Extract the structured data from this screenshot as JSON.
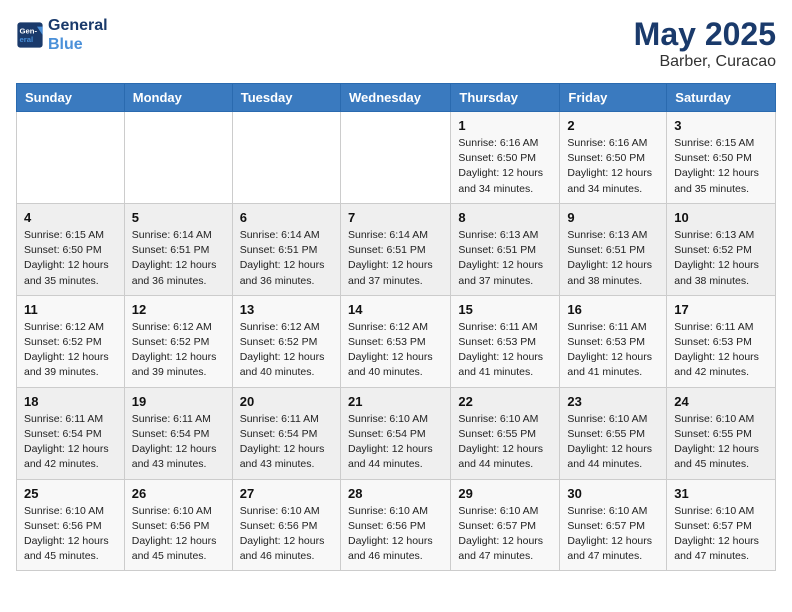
{
  "header": {
    "logo_line1": "General",
    "logo_line2": "Blue",
    "title": "May 2025",
    "subtitle": "Barber, Curacao"
  },
  "days_of_week": [
    "Sunday",
    "Monday",
    "Tuesday",
    "Wednesday",
    "Thursday",
    "Friday",
    "Saturday"
  ],
  "weeks": [
    [
      {
        "day": "",
        "info": ""
      },
      {
        "day": "",
        "info": ""
      },
      {
        "day": "",
        "info": ""
      },
      {
        "day": "",
        "info": ""
      },
      {
        "day": "1",
        "info": "Sunrise: 6:16 AM\nSunset: 6:50 PM\nDaylight: 12 hours and 34 minutes."
      },
      {
        "day": "2",
        "info": "Sunrise: 6:16 AM\nSunset: 6:50 PM\nDaylight: 12 hours and 34 minutes."
      },
      {
        "day": "3",
        "info": "Sunrise: 6:15 AM\nSunset: 6:50 PM\nDaylight: 12 hours and 35 minutes."
      }
    ],
    [
      {
        "day": "4",
        "info": "Sunrise: 6:15 AM\nSunset: 6:50 PM\nDaylight: 12 hours and 35 minutes."
      },
      {
        "day": "5",
        "info": "Sunrise: 6:14 AM\nSunset: 6:51 PM\nDaylight: 12 hours and 36 minutes."
      },
      {
        "day": "6",
        "info": "Sunrise: 6:14 AM\nSunset: 6:51 PM\nDaylight: 12 hours and 36 minutes."
      },
      {
        "day": "7",
        "info": "Sunrise: 6:14 AM\nSunset: 6:51 PM\nDaylight: 12 hours and 37 minutes."
      },
      {
        "day": "8",
        "info": "Sunrise: 6:13 AM\nSunset: 6:51 PM\nDaylight: 12 hours and 37 minutes."
      },
      {
        "day": "9",
        "info": "Sunrise: 6:13 AM\nSunset: 6:51 PM\nDaylight: 12 hours and 38 minutes."
      },
      {
        "day": "10",
        "info": "Sunrise: 6:13 AM\nSunset: 6:52 PM\nDaylight: 12 hours and 38 minutes."
      }
    ],
    [
      {
        "day": "11",
        "info": "Sunrise: 6:12 AM\nSunset: 6:52 PM\nDaylight: 12 hours and 39 minutes."
      },
      {
        "day": "12",
        "info": "Sunrise: 6:12 AM\nSunset: 6:52 PM\nDaylight: 12 hours and 39 minutes."
      },
      {
        "day": "13",
        "info": "Sunrise: 6:12 AM\nSunset: 6:52 PM\nDaylight: 12 hours and 40 minutes."
      },
      {
        "day": "14",
        "info": "Sunrise: 6:12 AM\nSunset: 6:53 PM\nDaylight: 12 hours and 40 minutes."
      },
      {
        "day": "15",
        "info": "Sunrise: 6:11 AM\nSunset: 6:53 PM\nDaylight: 12 hours and 41 minutes."
      },
      {
        "day": "16",
        "info": "Sunrise: 6:11 AM\nSunset: 6:53 PM\nDaylight: 12 hours and 41 minutes."
      },
      {
        "day": "17",
        "info": "Sunrise: 6:11 AM\nSunset: 6:53 PM\nDaylight: 12 hours and 42 minutes."
      }
    ],
    [
      {
        "day": "18",
        "info": "Sunrise: 6:11 AM\nSunset: 6:54 PM\nDaylight: 12 hours and 42 minutes."
      },
      {
        "day": "19",
        "info": "Sunrise: 6:11 AM\nSunset: 6:54 PM\nDaylight: 12 hours and 43 minutes."
      },
      {
        "day": "20",
        "info": "Sunrise: 6:11 AM\nSunset: 6:54 PM\nDaylight: 12 hours and 43 minutes."
      },
      {
        "day": "21",
        "info": "Sunrise: 6:10 AM\nSunset: 6:54 PM\nDaylight: 12 hours and 44 minutes."
      },
      {
        "day": "22",
        "info": "Sunrise: 6:10 AM\nSunset: 6:55 PM\nDaylight: 12 hours and 44 minutes."
      },
      {
        "day": "23",
        "info": "Sunrise: 6:10 AM\nSunset: 6:55 PM\nDaylight: 12 hours and 44 minutes."
      },
      {
        "day": "24",
        "info": "Sunrise: 6:10 AM\nSunset: 6:55 PM\nDaylight: 12 hours and 45 minutes."
      }
    ],
    [
      {
        "day": "25",
        "info": "Sunrise: 6:10 AM\nSunset: 6:56 PM\nDaylight: 12 hours and 45 minutes."
      },
      {
        "day": "26",
        "info": "Sunrise: 6:10 AM\nSunset: 6:56 PM\nDaylight: 12 hours and 45 minutes."
      },
      {
        "day": "27",
        "info": "Sunrise: 6:10 AM\nSunset: 6:56 PM\nDaylight: 12 hours and 46 minutes."
      },
      {
        "day": "28",
        "info": "Sunrise: 6:10 AM\nSunset: 6:56 PM\nDaylight: 12 hours and 46 minutes."
      },
      {
        "day": "29",
        "info": "Sunrise: 6:10 AM\nSunset: 6:57 PM\nDaylight: 12 hours and 47 minutes."
      },
      {
        "day": "30",
        "info": "Sunrise: 6:10 AM\nSunset: 6:57 PM\nDaylight: 12 hours and 47 minutes."
      },
      {
        "day": "31",
        "info": "Sunrise: 6:10 AM\nSunset: 6:57 PM\nDaylight: 12 hours and 47 minutes."
      }
    ]
  ]
}
